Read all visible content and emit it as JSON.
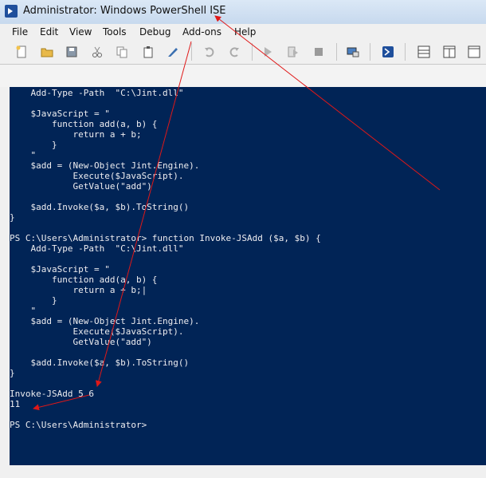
{
  "window": {
    "title": "Administrator: Windows PowerShell ISE"
  },
  "menu": [
    "File",
    "Edit",
    "View",
    "Tools",
    "Debug",
    "Add-ons",
    "Help"
  ],
  "toolbar": {
    "buttons": [
      "new-icon",
      "open-icon",
      "save-icon",
      "cut-icon",
      "copy-icon",
      "paste-icon",
      "clear-console-icon",
      "undo-icon",
      "redo-icon",
      "run-icon",
      "run-selection-icon",
      "stop-icon",
      "remote-powershell-icon",
      "start-powershell-exe-icon",
      "show-script-pane-top-icon",
      "show-script-pane-right-icon",
      "show-script-pane-maximized-icon"
    ]
  },
  "colors": {
    "console_bg": "#012456",
    "console_text": "#eeedf0",
    "arrow": "#e01818"
  },
  "console": {
    "lines": [
      "    Add-Type -Path  \"C:\\Jint.dll\"",
      "",
      "    $JavaScript = \"",
      "        function add(a, b) {",
      "            return a + b;",
      "        }",
      "    \"",
      "    $add = (New-Object Jint.Engine).",
      "            Execute($JavaScript).",
      "            GetValue(\"add\")",
      "",
      "    $add.Invoke($a, $b).ToString()",
      "}",
      "",
      "PS C:\\Users\\Administrator> function Invoke-JSAdd ($a, $b) {",
      "    Add-Type -Path  \"C:\\Jint.dll\"",
      "",
      "    $JavaScript = \"",
      "        function add(a, b) {",
      "            return a + b;|",
      "        }",
      "    \"",
      "    $add = (New-Object Jint.Engine).",
      "            Execute($JavaScript).",
      "            GetValue(\"add\")",
      "",
      "    $add.Invoke($a, $b).ToString()",
      "}",
      "",
      "Invoke-JSAdd 5 6",
      "11",
      "",
      "PS C:\\Users\\Administrator>"
    ]
  }
}
